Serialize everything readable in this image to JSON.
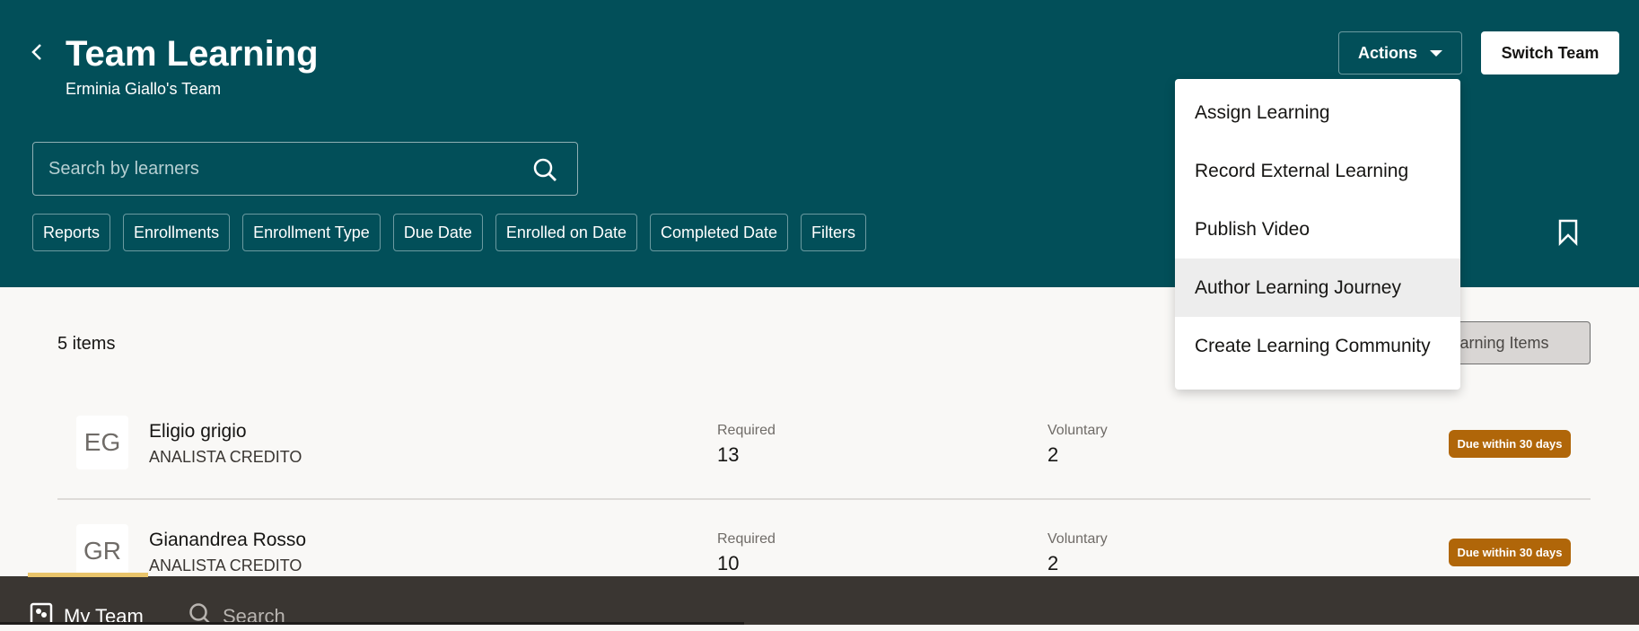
{
  "header": {
    "title": "Team Learning",
    "subtitle": "Erminia Giallo's Team",
    "actions_label": "Actions",
    "switch_team_label": "Switch Team"
  },
  "search": {
    "placeholder": "Search by learners",
    "value": ""
  },
  "filters": [
    "Reports",
    "Enrollments",
    "Enrollment Type",
    "Due Date",
    "Enrolled on Date",
    "Completed Date",
    "Filters"
  ],
  "actions_menu": [
    "Assign Learning",
    "Record External Learning",
    "Publish Video",
    "Author Learning Journey",
    "Create Learning Community"
  ],
  "list": {
    "count_label": "5 items",
    "learning_items_button": "Learning Items",
    "rows": [
      {
        "initials": "EG",
        "name": "Eligio grigio",
        "job": "ANALISTA CREDITO",
        "required_label": "Required",
        "required": "13",
        "voluntary_label": "Voluntary",
        "voluntary": "2",
        "badge": "Due within 30 days"
      },
      {
        "initials": "GR",
        "name": "Gianandrea Rosso",
        "job": "ANALISTA CREDITO",
        "required_label": "Required",
        "required": "10",
        "voluntary_label": "Voluntary",
        "voluntary": "2",
        "badge": "Due within 30 days"
      }
    ]
  },
  "bottom_nav": {
    "my_team": "My Team",
    "search": "Search"
  },
  "colors": {
    "header": "#024f59",
    "badge": "#b06609",
    "bottom_bar": "#3a3632",
    "active_underline": "#e9c46a"
  }
}
